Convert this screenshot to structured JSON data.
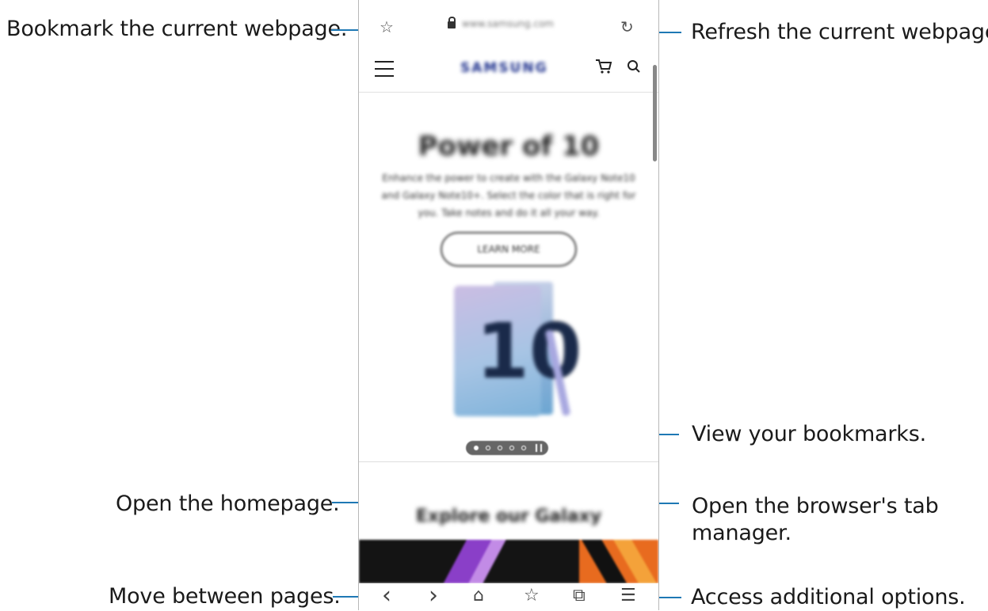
{
  "callouts": {
    "bookmark_current": "Bookmark the current webpage.",
    "refresh": "Refresh the current webpage.",
    "view_bookmarks": "View your bookmarks.",
    "homepage": "Open the homepage.",
    "tab_manager": "Open the browser's tab manager.",
    "move_pages": "Move between pages.",
    "additional_options": "Access additional options."
  },
  "browser": {
    "url": "www.samsung.com",
    "site_logo": "SAMSUNG",
    "hero_title": "Power of 10",
    "hero_text": "Enhance the power to create with the Galaxy Note10 and Galaxy Note10+. Select the color that is right for you. Take notes and do it all your way.",
    "learn_more": "LEARN MORE",
    "product_number": "10",
    "explore_heading": "Explore our Galaxy"
  },
  "icons": {
    "bookmark_star": "☆",
    "refresh": "↻",
    "cart": "🛒",
    "search": "⌕",
    "back": "‹",
    "forward": "›",
    "home": "⌂",
    "bookmarks": "☆",
    "tabs": "⧉",
    "menu": "☰"
  },
  "colors": {
    "leader_line": "#1e78b4",
    "logo": "#1c2f8c"
  }
}
